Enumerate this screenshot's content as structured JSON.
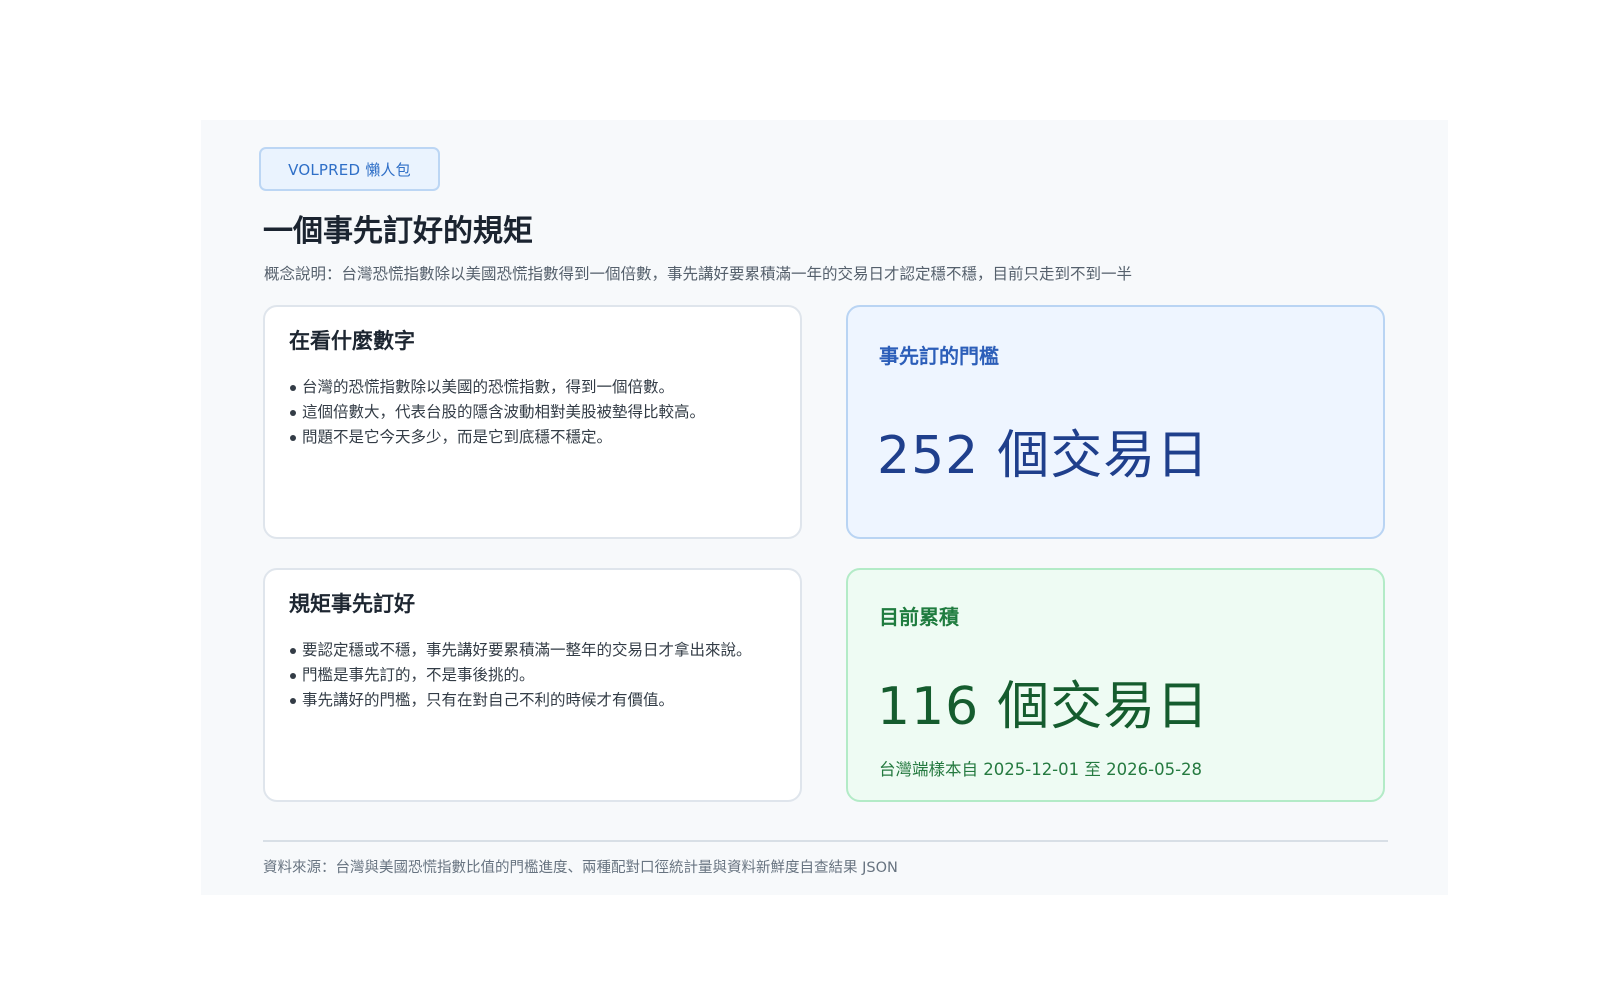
{
  "badge": "VOLPRED 懶人包",
  "title": "一個事先訂好的規矩",
  "concept": "概念說明：台灣恐慌指數除以美國恐慌指數得到一個倍數，事先講好要累積滿一年的交易日才認定穩不穩，目前只走到不到一半",
  "cards": {
    "what": {
      "title": "在看什麼數字",
      "bullets": [
        "台灣的恐慌指數除以美國的恐慌指數，得到一個倍數。",
        "這個倍數大，代表台股的隱含波動相對美股被墊得比較高。",
        "問題不是它今天多少，而是它到底穩不穩定。"
      ]
    },
    "rule": {
      "title": "規矩事先訂好",
      "bullets": [
        "要認定穩或不穩，事先講好要累積滿一整年的交易日才拿出來說。",
        "門檻是事先訂的，不是事後挑的。",
        "事先講好的門檻，只有在對自己不利的時候才有價值。"
      ]
    },
    "threshold": {
      "label": "事先訂的門檻",
      "value": "252",
      "unit": "個交易日"
    },
    "current": {
      "label": "目前累積",
      "value": "116",
      "unit": "個交易日",
      "sample_range": "台灣端樣本自 2025-12-01 至 2026-05-28"
    }
  },
  "source": "資料來源：台灣與美國恐慌指數比值的門檻進度、兩種配對口徑統計量與資料新鮮度自查結果 JSON",
  "colors": {
    "panel_bg": "#f7f9fb",
    "threshold_bg": "#eef5ff",
    "threshold_accent": "#1f3f8c",
    "current_bg": "#eefbf3",
    "current_accent": "#155c2e"
  }
}
